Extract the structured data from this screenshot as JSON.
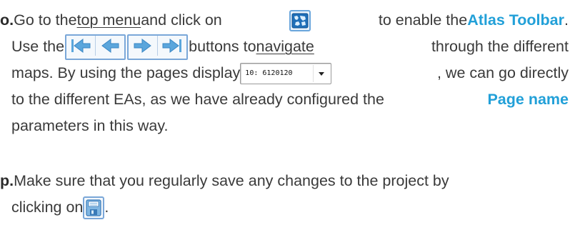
{
  "step_o": {
    "marker": "o.",
    "t1": "Go to the ",
    "link_top_menu": "top menu",
    "t2": " and click on ",
    "t3": " to enable the ",
    "atlas_toolbar": "Atlas Toolbar",
    "t4": ".",
    "t5": "Use the ",
    "t6": "buttons to ",
    "link_navigate": "navigate",
    "t7": " through the different",
    "t8": "maps. By using the pages display ",
    "page_value": "10: 6120120",
    "t9": ", we can go directly",
    "t10": "to the different EAs, as we have already configured the ",
    "page_name": "Page name",
    "t11": "parameters in this way."
  },
  "step_p": {
    "marker": "p.",
    "t1": "Make sure that you regularly save any changes to the project by",
    "t2": "clicking on ",
    "t3": "."
  },
  "icons": {
    "atlas": "atlas-toolbar-icon",
    "first": "first-feature-icon",
    "prev": "previous-feature-icon",
    "next": "next-feature-icon",
    "last": "last-feature-icon",
    "dropdown": "chevron-down-icon",
    "save": "save-project-icon"
  },
  "colors": {
    "text": "#3a3a3a",
    "keyword": "#22a0d8",
    "button_border": "#7aa7d8",
    "arrow": "#5ba6dc"
  }
}
